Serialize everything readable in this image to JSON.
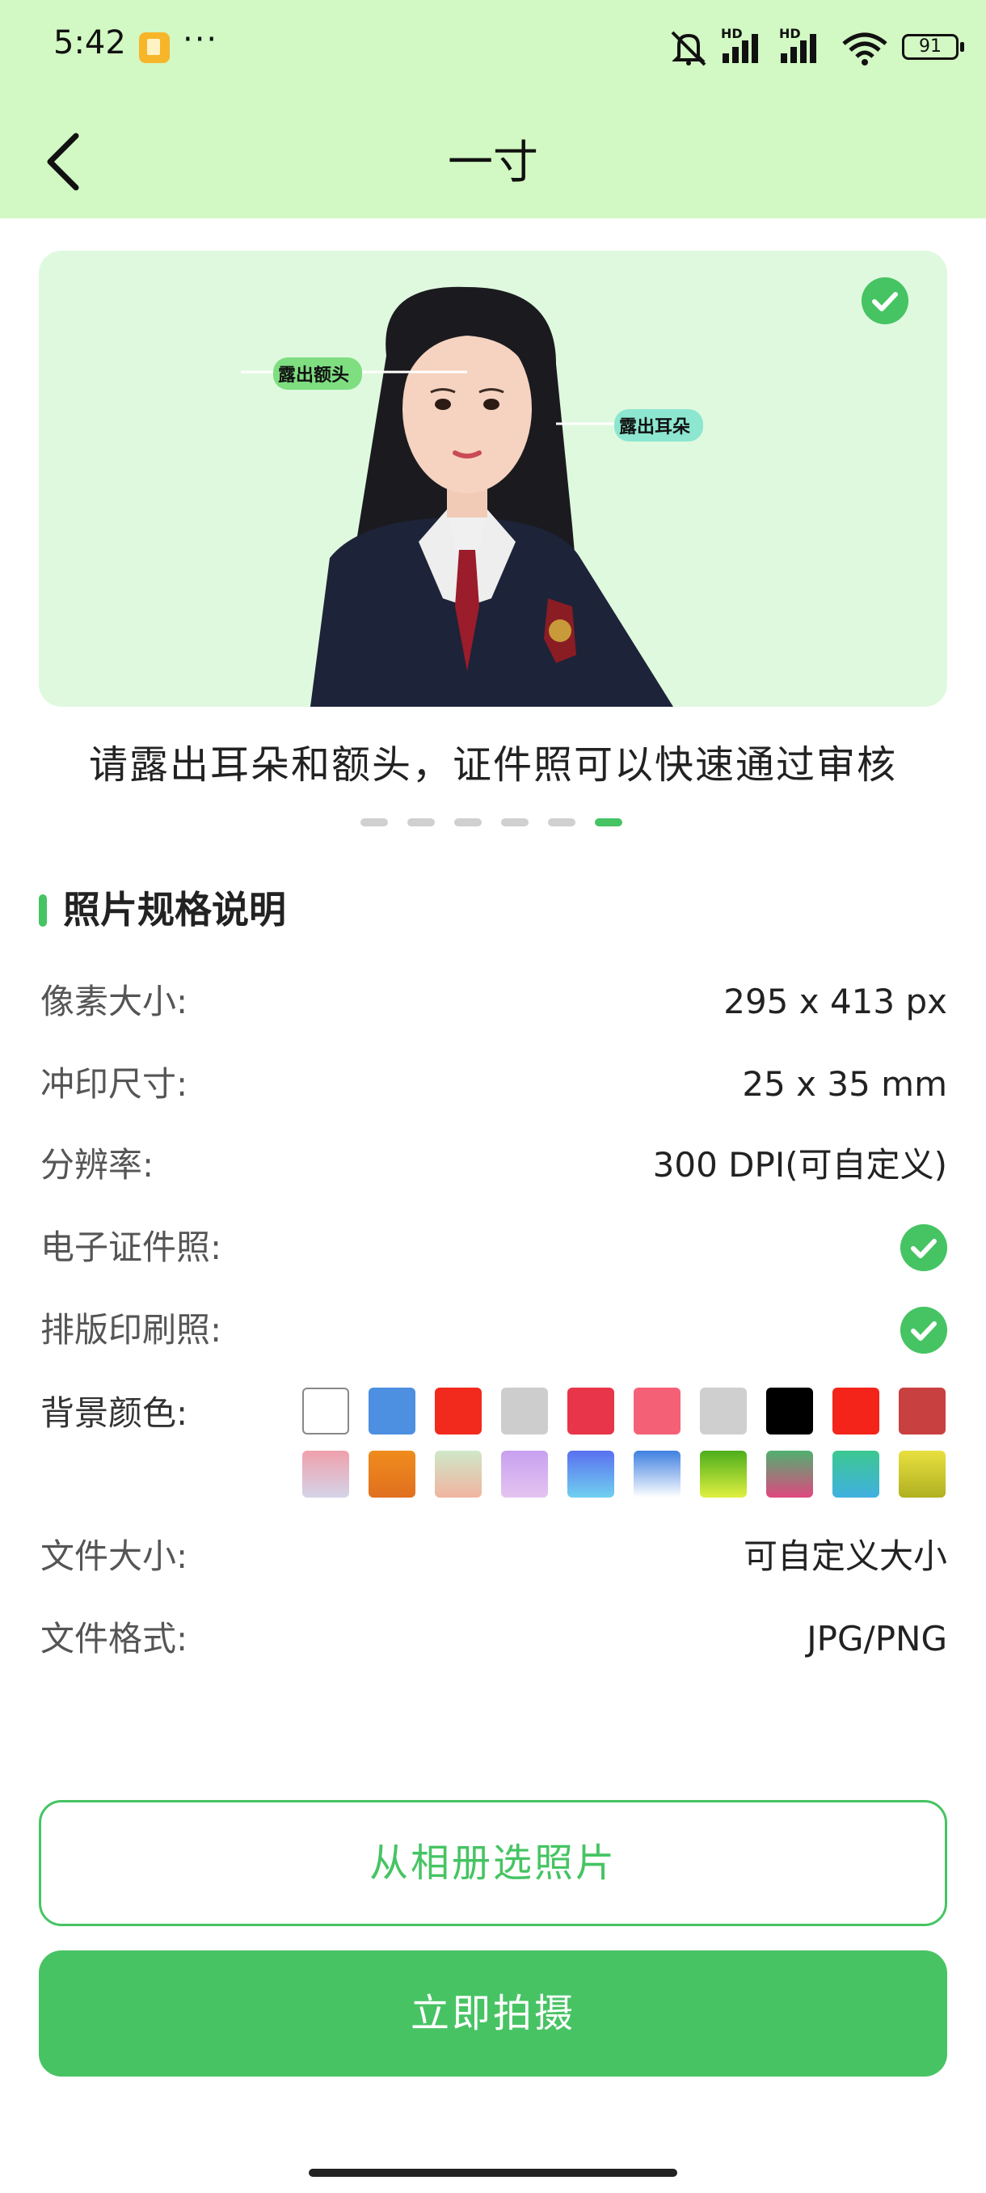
{
  "status_bar": {
    "time": "5:42",
    "more": "···",
    "battery": "91",
    "hd_1": "HD",
    "hd_2": "HD"
  },
  "header": {
    "title": "一寸",
    "back_icon": "chevron-left-icon"
  },
  "hero": {
    "tag_forehead": "露出额头",
    "tag_ears": "露出耳朵",
    "hint": "请露出耳朵和额头，证件照可以快速通过审核",
    "carousel_count": 6,
    "carousel_active": 6
  },
  "specs": {
    "title": "照片规格说明",
    "pixel_label": "像素大小:",
    "pixel_value": "295 x 413 px",
    "print_label": "冲印尺寸:",
    "print_value": "25 x 35 mm",
    "dpi_label": "分辨率:",
    "dpi_value": "300 DPI(可自定义)",
    "digital_label": "电子证件照:",
    "layout_label": "排版印刷照:",
    "bg_label": "背景颜色:",
    "filesize_label": "文件大小:",
    "filesize_value": "可自定义大小",
    "format_label": "文件格式:",
    "format_value": "JPG/PNG"
  },
  "background_colors": [
    "#ffffff",
    "#4d8fe0",
    "#f22a1e",
    "#cdcdcd",
    "#e8354a",
    "#f46177",
    "#cfcfcf",
    "#000000",
    "#f4241a",
    "#c94040",
    "linear-gradient(#f0a0ac,#d4d4e8)",
    "linear-gradient(#f08c1c,#e07020)",
    "linear-gradient(#cfe8c8,#f0b4a0)",
    "linear-gradient(#c8a0f0,#e4c4f0)",
    "linear-gradient(#5a70f0,#70d0f0)",
    "linear-gradient(#4080e0,#ffffff)",
    "linear-gradient(#4cae1c,#e0f040)",
    "linear-gradient(#50b070,#e04880)",
    "linear-gradient(#3cc890,#40b0e0)",
    "linear-gradient(#e8e040,#b0b020)"
  ],
  "buttons": {
    "album": "从相册选照片",
    "shoot": "立即拍摄"
  },
  "colors": {
    "accent": "#46c463",
    "header_bg": "#d2f8c3"
  }
}
